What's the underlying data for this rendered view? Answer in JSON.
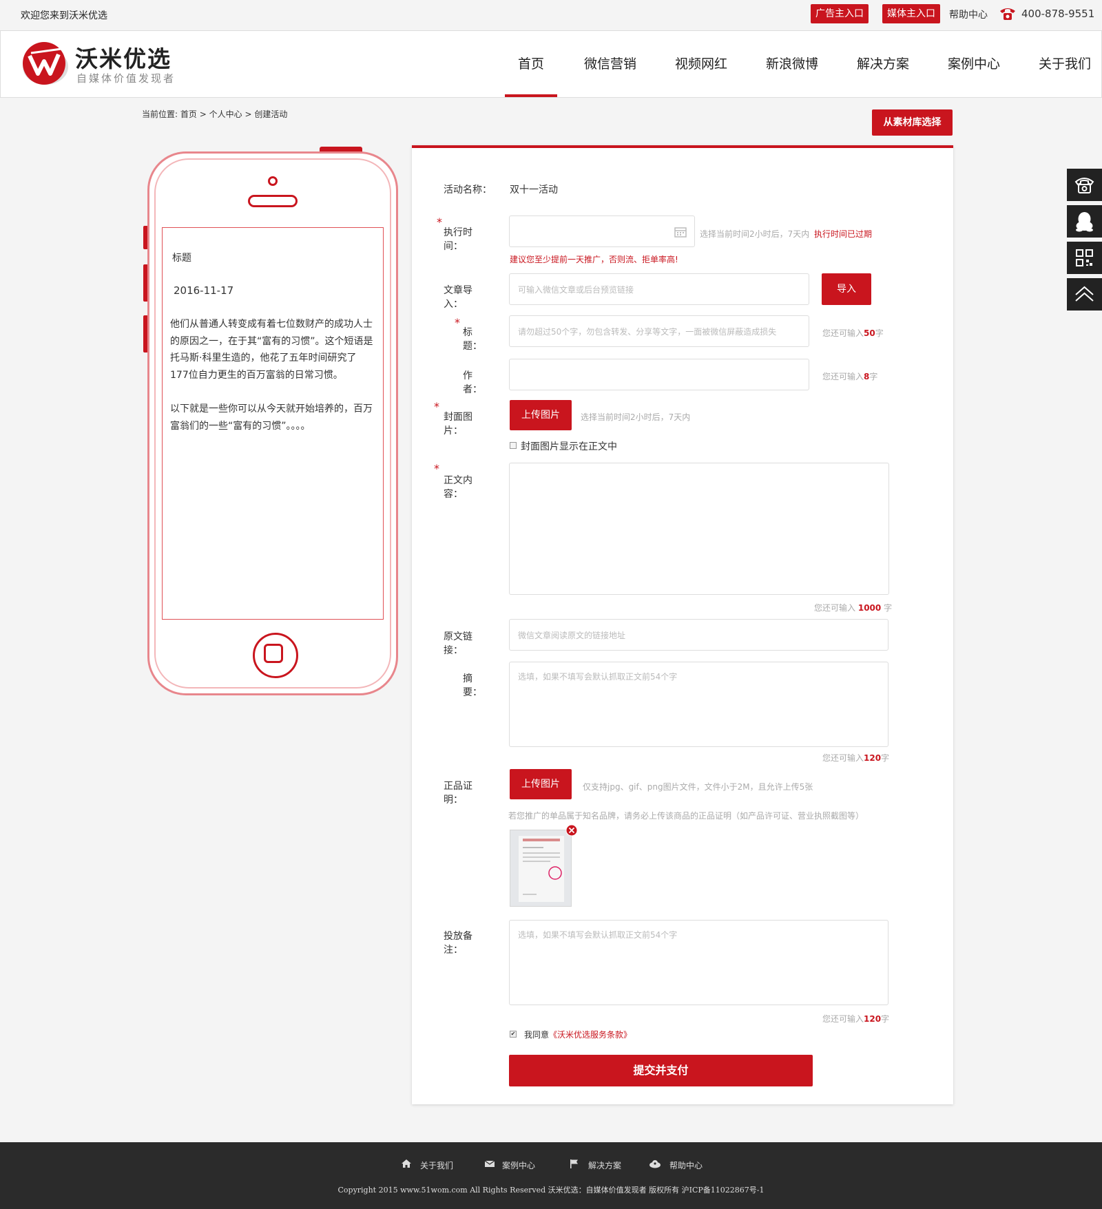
{
  "topbar": {
    "welcome": "欢迎您来到沃米优选",
    "ad_entry": "广告主入口",
    "media_entry": "媒体主入口",
    "help": "帮助中心",
    "hotline": "400-878-9551"
  },
  "brand": {
    "name": "沃米优选",
    "slogan": "自媒体价值发现者"
  },
  "nav": {
    "items": [
      "首页",
      "微信营销",
      "视频网红",
      "新浪微博",
      "解决方案",
      "案例中心",
      "关于我们"
    ],
    "active": 0
  },
  "breadcrumb": {
    "prefix": "当前位置:",
    "home": "首页",
    "sep": ">",
    "mid": "个人中心",
    "current": "创建活动"
  },
  "material_btn": "从素材库选择",
  "preview": {
    "title": "标题",
    "date": "2016-11-17",
    "para1": "他们从普通人转变成有着七位数财产的成功人士的原因之一，在于其“富有的习惯”。这个短语是托马斯·科里生造的，他花了五年时间研究了177位自力更生的百万富翁的日常习惯。",
    "para2": "以下就是一些你可以从今天就开始培养的，百万富翁们的一些“富有的习惯”。。。。"
  },
  "form": {
    "activity_label": "活动名称：",
    "activity_value": "双十一活动",
    "exec_label": "执行时间：",
    "exec_hint": "选择当前时间2小时后，7天内",
    "exec_expired": "执行时间已过期",
    "exec_warning": "建议您至少提前一天推广，否则流、拒单率高!",
    "import_label": "文章导入：",
    "import_placeholder": "可输入微信文章或后台预览链接",
    "import_btn": "导入",
    "title_label": "标题：",
    "title_placeholder": "请勿超过50个字，勿包含转发、分享等文字，一面被微信屏蔽造成损失",
    "title_remain_prefix": "您还可输入",
    "title_remain": "50",
    "remain_suffix": "字",
    "author_label": "作者：",
    "author_remain": "8",
    "cover_label": "封面图片：",
    "upload_btn": "上传图片",
    "cover_hint": "选择当前时间2小时后，7天内",
    "cover_show": "封面图片显示在正文中",
    "content_label": "正文内容：",
    "content_remain": "1000",
    "link_label": "原文链接：",
    "link_placeholder": "微信文章阅读原文的链接地址",
    "summary_label": "摘要：",
    "summary_placeholder": "选填，如果不填写会默认抓取正文前54个字",
    "summary_remain": "120",
    "proof_label": "正品证明：",
    "proof_hint": "仅支持jpg、gif、png图片文件，文件小于2M，且允许上传5张",
    "proof_note": "若您推广的单品属于知名品牌，请务必上传该商品的正品证明（如产品许可证、营业执照截图等）",
    "notes_label": "投放备注：",
    "notes_placeholder": "选填，如果不填写会默认抓取正文前54个字",
    "notes_remain": "120",
    "agree_prefix": "我同意",
    "agree_link": "《沃米优选服务条款》",
    "submit": "提交并支付"
  },
  "footer": {
    "links": [
      "关于我们",
      "案例中心",
      "解决方案",
      "帮助中心"
    ],
    "copyright": "Copyright 2015 www.51wom.com All Rights Reserved 沃米优选：自媒体价值发现者 版权所有 沪ICP备11022867号-1"
  },
  "colors": {
    "accent": "#c9151e",
    "footer_bg": "#2b2b2b"
  }
}
